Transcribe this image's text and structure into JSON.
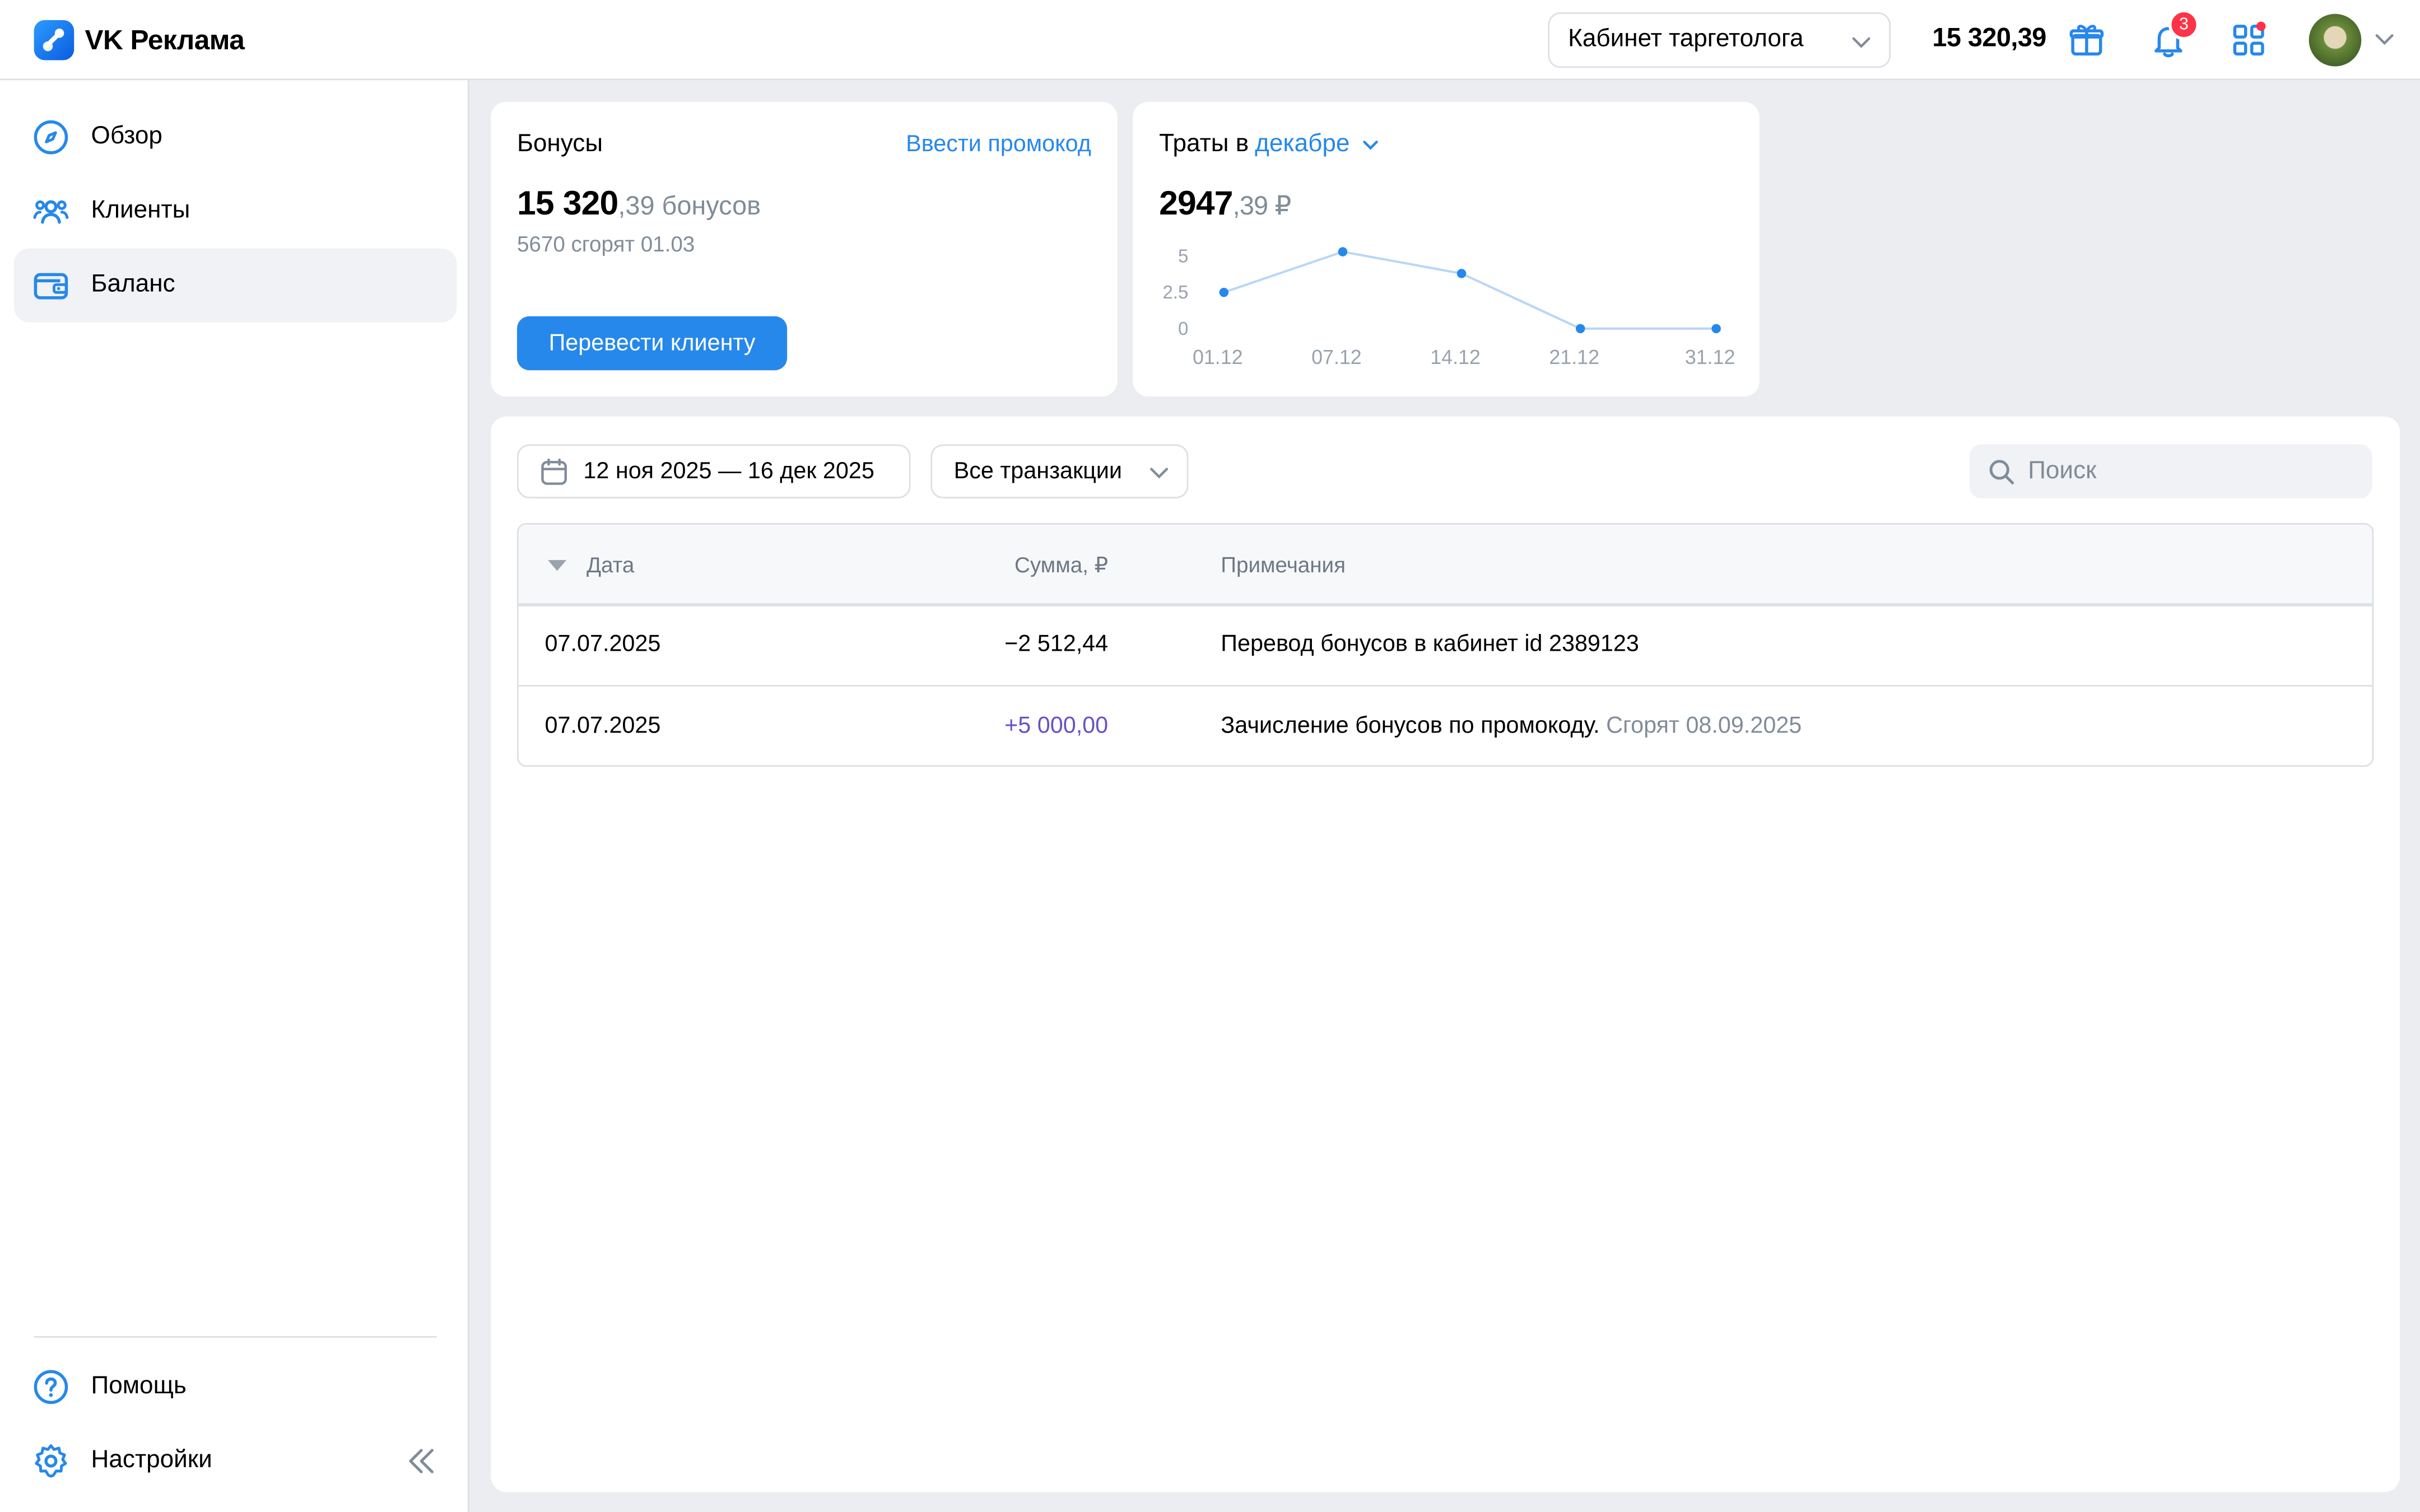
{
  "header": {
    "app_name": "VK Реклама",
    "cabinet": "Кабинет таргетолога",
    "balance": "15 320,39",
    "notifications_count": "3"
  },
  "sidebar": {
    "items": [
      {
        "label": "Обзор",
        "icon": "compass-icon"
      },
      {
        "label": "Клиенты",
        "icon": "users-icon"
      },
      {
        "label": "Баланс",
        "icon": "wallet-icon",
        "active": true
      }
    ],
    "bottom": [
      {
        "label": "Помощь",
        "icon": "help-icon"
      },
      {
        "label": "Настройки",
        "icon": "gear-icon"
      }
    ]
  },
  "bonus_card": {
    "title": "Бонусы",
    "promo_link": "Ввести промокод",
    "amount_main": "15 320",
    "amount_suffix": ",39 бонусов",
    "expire": "5670 сгорят 01.03",
    "button": "Перевести клиенту"
  },
  "spend_card": {
    "title": "Траты в",
    "month": "декабре",
    "amount_main": "2947",
    "amount_suffix": ",39 ₽"
  },
  "chart_data": {
    "type": "line",
    "categories": [
      "01.12",
      "07.12",
      "14.12",
      "21.12",
      "31.12"
    ],
    "values": [
      2.5,
      5.3,
      3.8,
      0,
      0
    ],
    "y_ticks": [
      "0",
      "2.5",
      "5"
    ],
    "ylim": [
      0,
      5
    ],
    "grid": false,
    "color": "#2688eb"
  },
  "transactions": {
    "date_range": "12 ноя 2025 — 16 дек 2025",
    "filter": "Все транзакции",
    "search_placeholder": "Поиск",
    "columns": {
      "date": "Дата",
      "sum": "Сумма, ₽",
      "notes": "Примечания"
    },
    "rows": [
      {
        "date": "07.07.2025",
        "sum": "−2 512,44",
        "note": "Перевод бонусов в кабинет id 2389123",
        "note_sub": ""
      },
      {
        "date": "07.07.2025",
        "sum": "+5 000,00",
        "note": "Зачисление бонусов по промокоду.",
        "note_sub": " Сгорят 08.09.2025"
      }
    ]
  }
}
